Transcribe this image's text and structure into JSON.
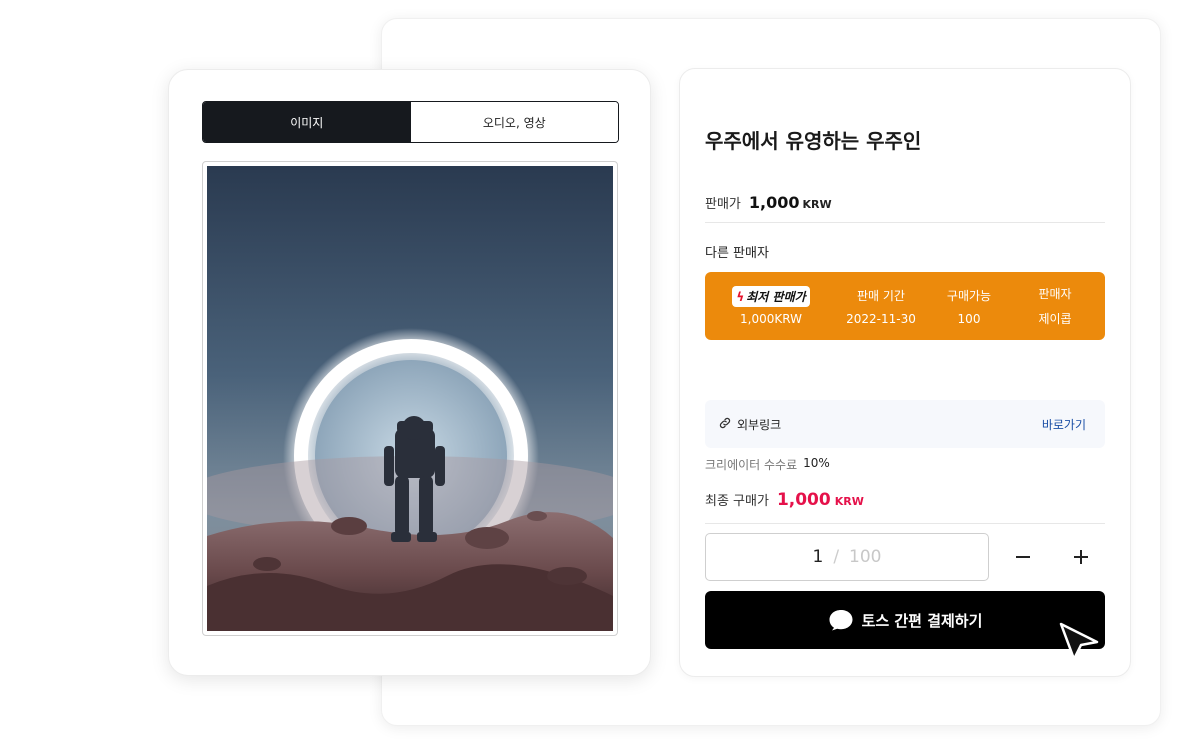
{
  "media_tabs": [
    {
      "label": "이미지",
      "active": true
    },
    {
      "label": "오디오, 영상",
      "active": false
    }
  ],
  "product": {
    "title": "우주에서 유영하는 우주인",
    "price_label": "판매가",
    "price_value": "1,000",
    "price_unit": "KRW"
  },
  "other_sellers": {
    "label": "다른 판매자",
    "best_badge": "최저 판매가",
    "best_price": "1,000KRW",
    "period_label": "판매 기간",
    "period_value": "2022-11-30",
    "available_label": "구매가능",
    "available_value": "100",
    "seller_label": "판매자",
    "seller_value": "제이콥",
    "color": "#ec8a0c"
  },
  "external_link": {
    "label": "외부링크",
    "action": "바로가기"
  },
  "fee": {
    "label": "크리에이터 수수료",
    "value": "10%"
  },
  "final": {
    "label": "최종 구매가",
    "value": "1,000",
    "unit": "KRW",
    "color": "#e5114a"
  },
  "quantity": {
    "current": "1",
    "separator": "/",
    "max": "100"
  },
  "pay_button": {
    "label": "토스 간편 결제하기"
  },
  "icons": [
    "link-icon",
    "minus-icon",
    "plus-icon",
    "toss-icon",
    "cursor-icon",
    "bolt-icon"
  ]
}
